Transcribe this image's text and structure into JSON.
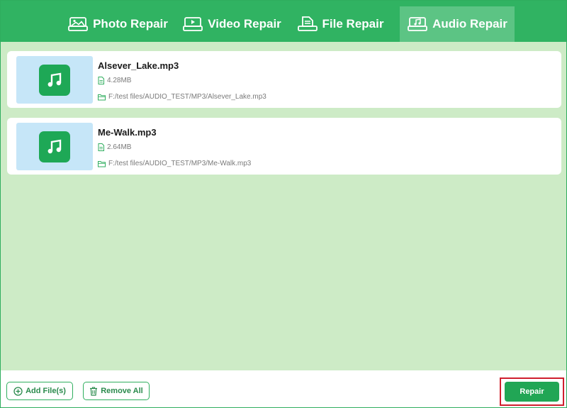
{
  "tabs": [
    {
      "label": "Photo Repair",
      "icon": "photo-icon",
      "active": false
    },
    {
      "label": "Video Repair",
      "icon": "video-icon",
      "active": false
    },
    {
      "label": "File Repair",
      "icon": "file-icon",
      "active": false
    },
    {
      "label": "Audio Repair",
      "icon": "audio-icon",
      "active": true
    }
  ],
  "files": [
    {
      "name": "Alsever_Lake.mp3",
      "size": "4.28MB",
      "path": "F:/test files/AUDIO_TEST/MP3/Alsever_Lake.mp3",
      "icon": "music-note-icon"
    },
    {
      "name": "Me-Walk.mp3",
      "size": "2.64MB",
      "path": "F:/test files/AUDIO_TEST/MP3/Me-Walk.mp3",
      "icon": "music-note-icon"
    }
  ],
  "footer": {
    "add_label": "Add File(s)",
    "remove_label": "Remove All",
    "repair_label": "Repair"
  },
  "colors": {
    "header": "#30b362",
    "active_tab": "#5cc484",
    "content_bg": "#cdebc6",
    "thumb_bg": "#c6e6f8",
    "primary": "#21a655",
    "highlight": "#d01f2e"
  }
}
